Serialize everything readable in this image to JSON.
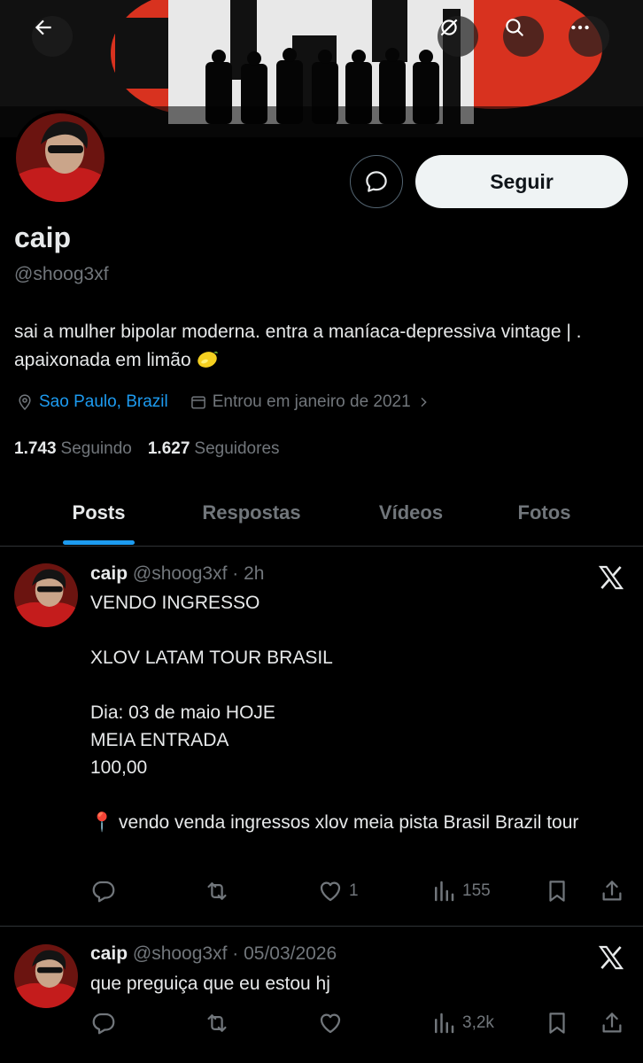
{
  "header": {
    "back_icon": "arrow-left-icon",
    "grok_icon": "grok-icon",
    "search_icon": "search-icon",
    "more_icon": "more-icon"
  },
  "profile": {
    "name": "caip",
    "handle": "@shoog3xf",
    "follow_label": "Seguir",
    "bio": "sai a mulher bipolar moderna. entra a maníaca-depressiva vintage | . apaixonada em limão",
    "location": "Sao Paulo, Brazil",
    "joined": "Entrou em janeiro de 2021",
    "following_count": "1.743",
    "following_label": "Seguindo",
    "followers_count": "1.627",
    "followers_label": "Seguidores"
  },
  "tabs": [
    {
      "label": "Posts",
      "active": true
    },
    {
      "label": "Respostas",
      "active": false
    },
    {
      "label": "Vídeos",
      "active": false
    },
    {
      "label": "Fotos",
      "active": false
    }
  ],
  "posts": [
    {
      "name": "caip",
      "meta": "@shoog3xf · 2h",
      "text": "VENDO INGRESSO\n\nXLOV LATAM TOUR BRASIL\n\nDia: 03 de maio HOJE\nMEIA ENTRADA\n100,00\n\n📍 vendo venda ingressos xlov meia pista Brasil Brazil tour",
      "likes": "1",
      "views": "155"
    },
    {
      "name": "caip",
      "meta": "@shoog3xf · 05/03/2026",
      "text": "que preguiça que eu estou hj",
      "likes": "",
      "views": "3,2k"
    }
  ],
  "colors": {
    "accent": "#1d9bf0",
    "background": "#000000",
    "muted": "#71767b",
    "text": "#e7e9ea",
    "banner_red": "#d8321f"
  }
}
